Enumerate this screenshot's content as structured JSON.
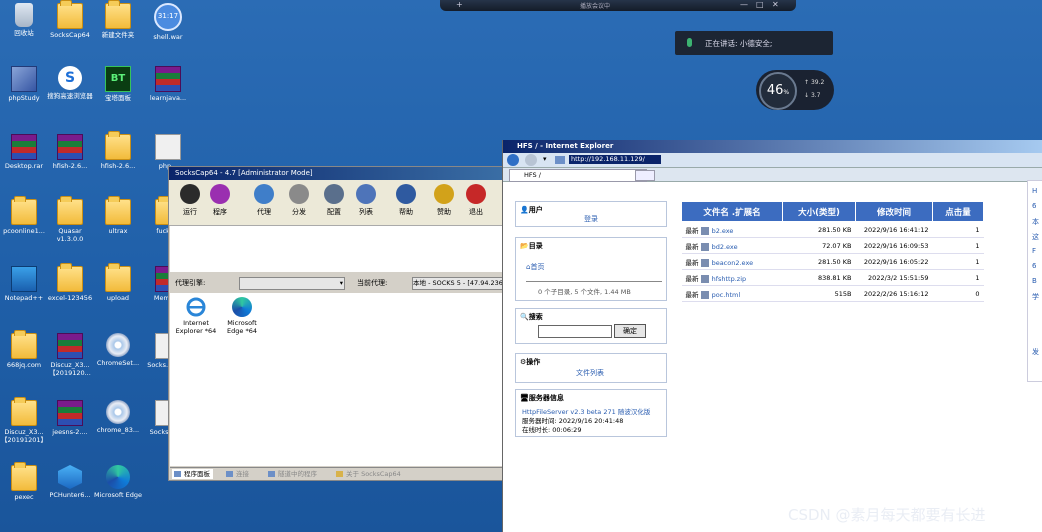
{
  "desktop": {
    "icons": [
      {
        "label": "回收站",
        "kind": "bin",
        "icon": "recycle-bin-icon"
      },
      {
        "label": "SocksCap64",
        "kind": "folder",
        "icon": "folder-icon"
      },
      {
        "label": "新建文件夹",
        "kind": "folder",
        "icon": "folder-icon"
      },
      {
        "label": "shell.war",
        "kind": "circ",
        "icon": "file-icon"
      },
      {
        "label": "phpStudy",
        "kind": "php",
        "icon": "phpstudy-icon"
      },
      {
        "label": "搜狗高速浏览器",
        "kind": "sogou",
        "icon": "sogou-browser-icon"
      },
      {
        "label": "宝塔面板",
        "kind": "bt",
        "icon": "bt-panel-icon"
      },
      {
        "label": "learnjava...",
        "kind": "rar",
        "icon": "archive-icon"
      },
      {
        "label": "Desktop.rar",
        "kind": "rar",
        "icon": "archive-icon"
      },
      {
        "label": "hfish-2.6...",
        "kind": "rar",
        "icon": "archive-icon"
      },
      {
        "label": "hfish-2.6...",
        "kind": "folder",
        "icon": "folder-icon"
      },
      {
        "label": "php...",
        "kind": "doc",
        "icon": "document-icon"
      },
      {
        "label": "pcoonline1...",
        "kind": "folder",
        "icon": "folder-icon"
      },
      {
        "label": "Quasar v1.3.0.0",
        "kind": "folder",
        "icon": "folder-icon"
      },
      {
        "label": "ultrax",
        "kind": "folder",
        "icon": "folder-icon"
      },
      {
        "label": "fucko...",
        "kind": "folder",
        "icon": "folder-icon"
      },
      {
        "label": "Notepad++",
        "kind": "notepad",
        "icon": "notepad-icon"
      },
      {
        "label": "excel-123456",
        "kind": "folder",
        "icon": "folder-icon"
      },
      {
        "label": "upload",
        "kind": "folder",
        "icon": "folder-icon"
      },
      {
        "label": "Memor...",
        "kind": "rar",
        "icon": "archive-icon"
      },
      {
        "label": "668jq.com",
        "kind": "folder",
        "icon": "folder-icon"
      },
      {
        "label": "Discuz_X3... 【2019120...",
        "kind": "rar",
        "icon": "archive-icon"
      },
      {
        "label": "ChromeSet...",
        "kind": "cd",
        "icon": "installer-icon"
      },
      {
        "label": "Socks... Vser",
        "kind": "doc",
        "icon": "shortcut-icon"
      },
      {
        "label": "Discuz_X3... 【20191201】",
        "kind": "folder",
        "icon": "folder-icon"
      },
      {
        "label": "jeesns-2....",
        "kind": "rar",
        "icon": "archive-icon"
      },
      {
        "label": "chrome_83...",
        "kind": "cd",
        "icon": "installer-icon"
      },
      {
        "label": "Socks... Mo",
        "kind": "doc",
        "icon": "shortcut-icon"
      },
      {
        "label": "pexec",
        "kind": "folder",
        "icon": "folder-icon"
      },
      {
        "label": "PCHunter6...",
        "kind": "pch",
        "icon": "pchunter-icon"
      },
      {
        "label": "Microsoft Edge",
        "kind": "edge",
        "icon": "edge-icon"
      }
    ],
    "clock": "31:17"
  },
  "topbar": {
    "caption": "播放会议中",
    "buttons": [
      "+",
      "—",
      "□",
      "✕"
    ]
  },
  "speaking": {
    "text": "正在讲话: 小德安全;"
  },
  "gauge": {
    "value": "46",
    "unit": "%",
    "up": "39.2",
    "down": "3.7"
  },
  "sockscap": {
    "title": "SocksCap64 - 4.7 [Administrator Mode]",
    "toolbar": [
      {
        "label": "运行",
        "icon": "play-icon",
        "color": "#2b2b2b"
      },
      {
        "label": "程序",
        "icon": "program-icon",
        "color": "#9a2fb0"
      },
      {
        "label": "代理",
        "icon": "proxy-icon",
        "color": "#3f7ec9"
      },
      {
        "label": "分发",
        "icon": "refresh-icon",
        "color": "#8a8a8a"
      },
      {
        "label": "配置",
        "icon": "gear-icon",
        "color": "#5a6f8c"
      },
      {
        "label": "列表",
        "icon": "list-icon",
        "color": "#4e74b9"
      },
      {
        "label": "帮助",
        "icon": "help-icon",
        "color": "#2f5aa0"
      },
      {
        "label": "赞助",
        "icon": "coin-icon",
        "color": "#d2a21a"
      },
      {
        "label": "退出",
        "icon": "exit-icon",
        "color": "#c62828"
      }
    ],
    "proxy_label": "代理引擎:",
    "current_label": "当前代理:",
    "current_value": "本地 - SOCKS 5 - [47.94.236",
    "apps": [
      {
        "label": "Internet Explorer *64",
        "icon": "ie-icon"
      },
      {
        "label": "Microsoft Edge *64",
        "icon": "edge-icon"
      }
    ],
    "tabs": [
      "程序面板",
      "连接",
      "隧道中的程序",
      "关于 SocksCap64"
    ]
  },
  "ie": {
    "title": "HFS / - Internet Explorer",
    "url": "http://192.168.11.129/",
    "tab": "HFS /",
    "user": {
      "heading": "用户",
      "login": "登录"
    },
    "dir": {
      "heading": "目录",
      "home": "首页",
      "summary": "0 个子目录, 5 个文件, 1.44 MB"
    },
    "search": {
      "heading": "搜索",
      "button": "确定"
    },
    "ops": {
      "heading": "操作",
      "list": "文件列表"
    },
    "server": {
      "heading": "服务器信息",
      "link": "HttpFileServer v2.3 beta 271 随波汉化版",
      "time": "服务器时间: 2022/9/16 20:41:48",
      "uptime": "在线时长: 00:06:29"
    },
    "headers": [
      "文件名 .扩展名",
      "大小(类型)",
      "修改时间",
      "点击量"
    ],
    "files": [
      {
        "tag": "最新",
        "name": "b2.exe",
        "size": "281.50 KB",
        "time": "2022/9/16 16:41:12",
        "hits": "1"
      },
      {
        "tag": "最新",
        "name": "bd2.exe",
        "size": "72.07 KB",
        "time": "2022/9/16 16:09:53",
        "hits": "1"
      },
      {
        "tag": "最新",
        "name": "beacon2.exe",
        "size": "281.50 KB",
        "time": "2022/9/16 16:05:22",
        "hits": "1"
      },
      {
        "tag": "最新",
        "name": "hfshttp.zip",
        "size": "838.81 KB",
        "time": "2022/3/2 15:51:59",
        "hits": "1"
      },
      {
        "tag": "最新",
        "name": "poc.html",
        "size": "515B",
        "time": "2022/2/26 15:16:12",
        "hits": "0"
      }
    ],
    "side": [
      "H",
      "6",
      "本",
      "这",
      "F",
      "6",
      "B",
      "学",
      "发"
    ]
  },
  "watermark": "CSDN @素月每天都要有长进",
  "colors": {
    "desktop": "#1f5fa8",
    "table_header": "#3c6cc0",
    "link": "#2a5db0"
  }
}
